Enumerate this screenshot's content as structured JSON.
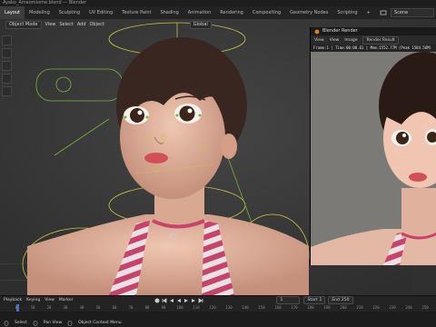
{
  "window": {
    "title": "Ayako_Ameomiome.blend — Blender"
  },
  "workspaces": [
    "Layout",
    "Modeling",
    "Sculpting",
    "UV Editing",
    "Texture Paint",
    "Shading",
    "Animation",
    "Rendering",
    "Compositing",
    "Geometry Nodes",
    "Scripting",
    "+"
  ],
  "active_workspace": 0,
  "scene": {
    "label": "Scene"
  },
  "viewport": {
    "mode": "Object Mode",
    "menus": [
      "View",
      "Select",
      "Add",
      "Object"
    ],
    "orientation": "Global"
  },
  "render_window": {
    "title": "Blender Render",
    "menus": [
      "View",
      "View",
      "Image"
    ],
    "slot": "Render Result",
    "info": "Frame:1 | Time:00:00.61 | Mem:1552.77M (Peak 1584.56M)"
  },
  "timeline": {
    "playback_label": "Playback",
    "keying_label": "Keying",
    "view_label": "View",
    "marker_label": "Marker",
    "current_frame": "1",
    "start_label": "Start",
    "start": "1",
    "end_label": "End",
    "end": "250",
    "ruler": [
      "0",
      "10",
      "20",
      "30",
      "40",
      "50",
      "60",
      "70",
      "80",
      "90",
      "100",
      "110",
      "120",
      "130",
      "140",
      "150",
      "160",
      "170",
      "180",
      "190",
      "200",
      "210",
      "220",
      "230",
      "240",
      "250"
    ]
  },
  "statusbar": {
    "left": "Select",
    "middle": "Pan View",
    "right": "Object Context Menu"
  },
  "colors": {
    "accent": "#4772b3",
    "armature": "#c9c34a",
    "armature_green": "#78b43c",
    "stripe_pink": "#c8436a"
  }
}
